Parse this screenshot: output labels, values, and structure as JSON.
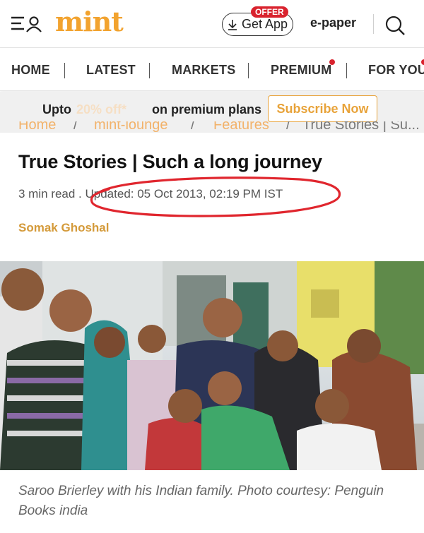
{
  "header": {
    "logo": "mint",
    "offer_badge": "OFFER",
    "get_app_label": "Get App",
    "epaper_label": "e-paper"
  },
  "nav": {
    "items": [
      {
        "label": "HOME"
      },
      {
        "label": "LATEST"
      },
      {
        "label": "MARKETS"
      },
      {
        "label": "PREMIUM"
      },
      {
        "label": "FOR YOU"
      }
    ]
  },
  "promo": {
    "prefix": "Upto",
    "highlight": "20% off*",
    "suffix": "on premium plans",
    "subscribe_label": "Subscribe Now"
  },
  "breadcrumb": {
    "items": [
      "Home",
      "mint-lounge",
      "Features",
      "True Stories | Su..."
    ]
  },
  "article": {
    "title": "True Stories | Such a long journey",
    "read_time": "3 min read .",
    "updated": "Updated: 05 Oct 2013, 02:19 PM IST",
    "author": "Somak Ghoshal",
    "caption": "Saroo Brierley with his Indian family. Photo courtesy: Penguin Books india"
  },
  "colors": {
    "brand": "#f2a32f",
    "offer_red": "#d9232e",
    "annotation_red": "#e0262e",
    "author": "#d49a3a"
  }
}
